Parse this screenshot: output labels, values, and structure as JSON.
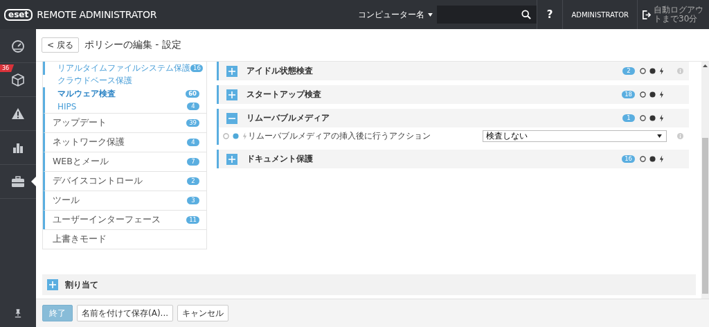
{
  "topbar": {
    "logo": "eset",
    "product": "REMOTE ADMINISTRATOR",
    "search_scope": "コンピューター名",
    "help": "?",
    "user": "ADMINISTRATOR",
    "logout": "自動ログアウトまで30分"
  },
  "nav": [
    {
      "selected": false
    },
    {
      "selected": false,
      "badge": "36"
    },
    {
      "selected": false
    },
    {
      "selected": false
    },
    {
      "selected": true
    }
  ],
  "header": {
    "back": "< 戻る",
    "title": "ポリシーの編集 - 設定"
  },
  "tree": [
    {
      "kind": "sub",
      "label": "リアルタイムファイルシステム保護",
      "count": "16",
      "applied": true,
      "selected": false
    },
    {
      "kind": "sub",
      "label": "クラウドベース保護",
      "applied": false,
      "selected": false
    },
    {
      "kind": "sub",
      "label": "マルウェア検査",
      "count": "60",
      "applied": true,
      "selected": true
    },
    {
      "kind": "sub",
      "label": "HIPS",
      "count": "4",
      "applied": true,
      "selected": false
    },
    {
      "kind": "main",
      "label": "アップデート",
      "count": "39",
      "applied": true
    },
    {
      "kind": "main",
      "label": "ネットワーク保護",
      "count": "4",
      "applied": true
    },
    {
      "kind": "main",
      "label": "WEBとメール",
      "count": "7",
      "applied": true
    },
    {
      "kind": "main",
      "label": "デバイスコントロール",
      "count": "2",
      "applied": true
    },
    {
      "kind": "main",
      "label": "ツール",
      "count": "3",
      "applied": true
    },
    {
      "kind": "main",
      "label": "ユーザーインターフェース",
      "count": "11",
      "applied": true
    },
    {
      "kind": "main",
      "label": "上書きモード",
      "applied": false
    }
  ],
  "sections": [
    {
      "kind": "group",
      "title": "アイドル状態検査",
      "count": "2",
      "expanded": false,
      "info": true
    },
    {
      "kind": "group",
      "title": "スタートアップ検査",
      "count": "18",
      "expanded": false,
      "info": false
    },
    {
      "kind": "group",
      "title": "リムーバブルメディア",
      "count": "1",
      "expanded": true,
      "info": false
    },
    {
      "kind": "setting",
      "label": "リムーバブルメディアの挿入後に行うアクション",
      "value": "検査しない",
      "applied": true,
      "info": true
    },
    {
      "kind": "group",
      "title": "ドキュメント保護",
      "count": "16",
      "expanded": false,
      "info": false
    }
  ],
  "assign": {
    "title": "割り当て",
    "expanded": false
  },
  "buttons": [
    {
      "label": "終了",
      "primary": true
    },
    {
      "label": "名前を付けて保存(A)...",
      "primary": false
    },
    {
      "label": "キャンセル",
      "primary": false
    }
  ]
}
